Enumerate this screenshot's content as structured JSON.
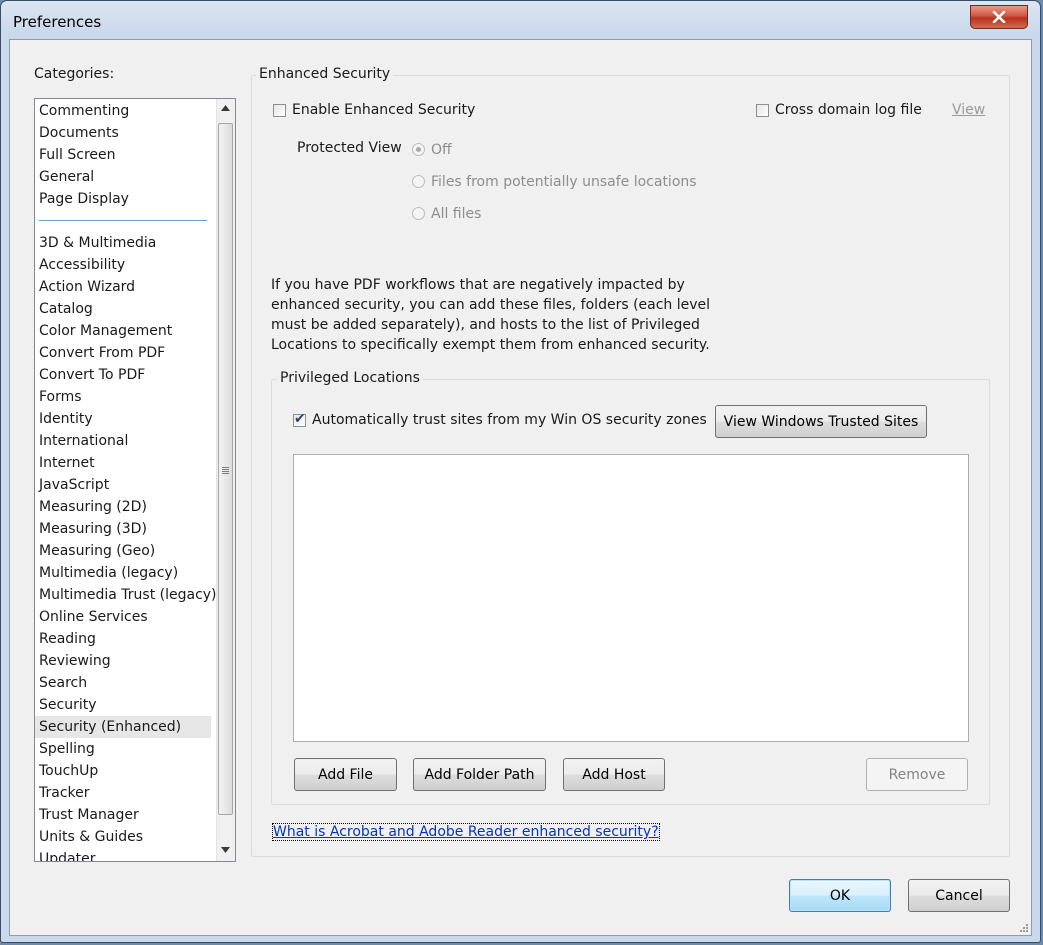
{
  "window": {
    "title": "Preferences",
    "close_icon": "close-icon"
  },
  "categories": {
    "label": "Categories:",
    "items_top": [
      "Commenting",
      "Documents",
      "Full Screen",
      "General",
      "Page Display"
    ],
    "items": [
      "3D & Multimedia",
      "Accessibility",
      "Action Wizard",
      "Catalog",
      "Color Management",
      "Convert From PDF",
      "Convert To PDF",
      "Forms",
      "Identity",
      "International",
      "Internet",
      "JavaScript",
      "Measuring (2D)",
      "Measuring (3D)",
      "Measuring (Geo)",
      "Multimedia (legacy)",
      "Multimedia Trust (legacy)",
      "Online Services",
      "Reading",
      "Reviewing",
      "Search",
      "Security",
      "Security (Enhanced)",
      "Spelling",
      "TouchUp",
      "Tracker",
      "Trust Manager",
      "Units & Guides",
      "Updater"
    ],
    "selected": "Security (Enhanced)"
  },
  "enhanced_security": {
    "group_label": "Enhanced Security",
    "enable_label": "Enable Enhanced Security",
    "enable_checked": false,
    "cross_domain_label": "Cross domain log file",
    "cross_domain_checked": false,
    "view_link": "View",
    "protected_view_label": "Protected View",
    "protected_view_options": [
      "Off",
      "Files from potentially unsafe locations",
      "All files"
    ],
    "protected_view_selected": "Off",
    "description": "If you have PDF workflows that are negatively impacted by enhanced security, you can add these files, folders (each level must be added separately), and hosts to the list of Privileged Locations to specifically exempt them from enhanced security."
  },
  "privileged_locations": {
    "group_label": "Privileged Locations",
    "auto_trust_label": "Automatically trust sites from my Win OS security zones",
    "auto_trust_checked": true,
    "view_trusted_button": "View Windows Trusted Sites",
    "add_file_button": "Add File",
    "add_folder_button": "Add Folder Path",
    "add_host_button": "Add Host",
    "remove_button": "Remove"
  },
  "help_link": "What is Acrobat and Adobe Reader enhanced security?",
  "footer": {
    "ok_button": "OK",
    "cancel_button": "Cancel"
  }
}
